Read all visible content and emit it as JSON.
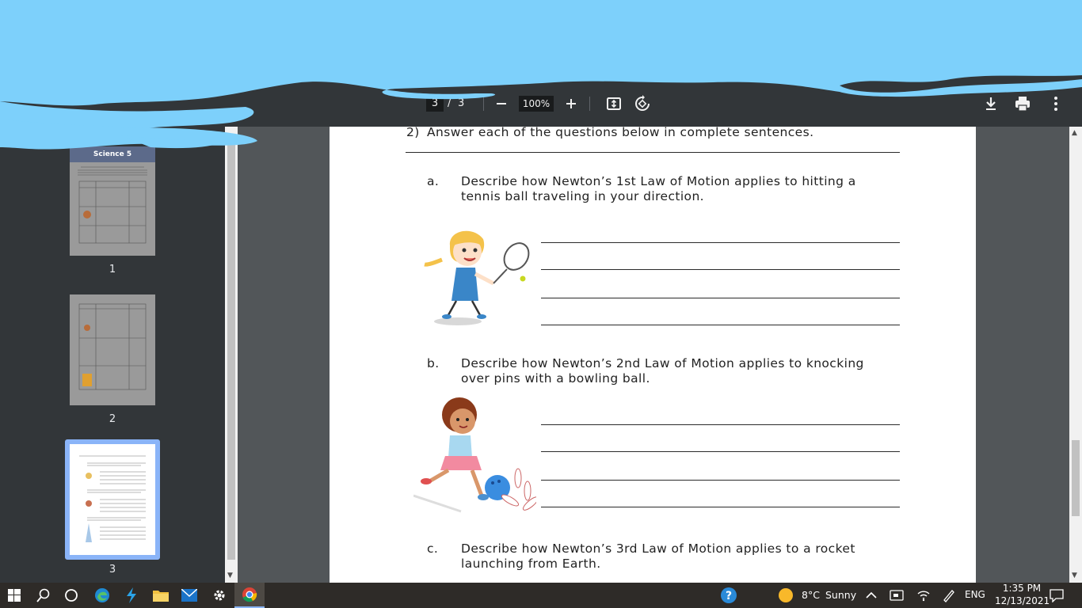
{
  "toolbar": {
    "page_current": "3",
    "page_separator": "/",
    "page_total": "3",
    "zoom": "100%"
  },
  "sidebar": {
    "thumbnails": [
      {
        "label": "1"
      },
      {
        "label": "2"
      },
      {
        "label": "3",
        "selected": true
      }
    ],
    "thumb1_banner": "Science 5"
  },
  "document": {
    "heading_number": "2)",
    "heading_text": "Answer each of the questions below in complete sentences.",
    "questions": [
      {
        "letter": "a.",
        "line1": "Describe how Newton’s 1st Law of Motion applies to hitting a",
        "line2": "tennis ball traveling in your direction."
      },
      {
        "letter": "b.",
        "line1": "Describe how Newton’s 2nd Law of Motion applies to knocking",
        "line2": "over pins with a bowling ball."
      },
      {
        "letter": "c.",
        "line1": "Describe how Newton’s 3rd Law of Motion applies to a rocket",
        "line2": "launching from Earth."
      }
    ]
  },
  "taskbar": {
    "weather_temp": "8°C",
    "weather_desc": "Sunny",
    "language": "ENG",
    "time": "1:35 PM",
    "date": "12/13/2021"
  },
  "colors": {
    "toolbar_bg": "#323639",
    "viewer_bg": "#525659",
    "selected_thumb_border": "#8ab4f8",
    "scribble": "#7dd0fb",
    "taskbar_bg": "#2e2b28"
  }
}
